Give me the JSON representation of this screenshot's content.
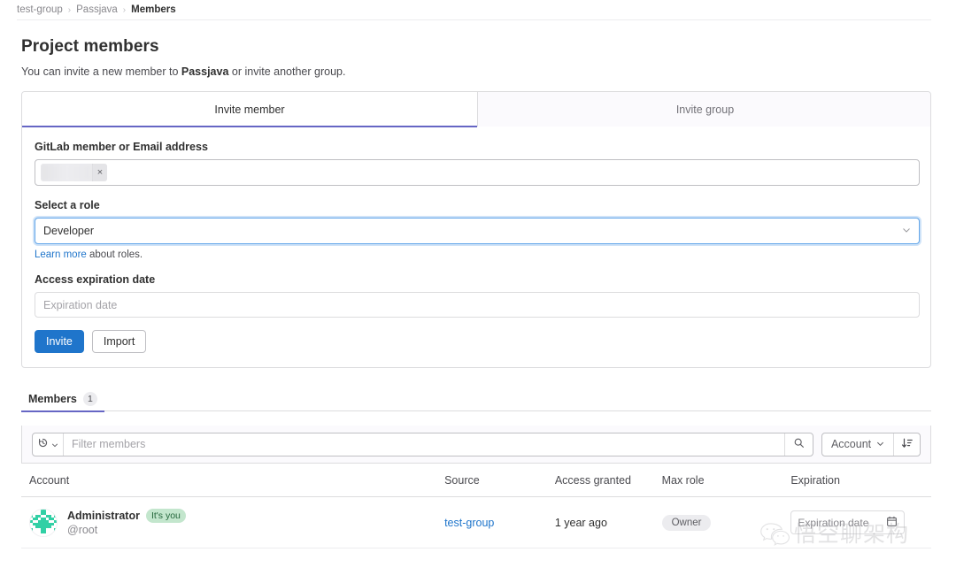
{
  "breadcrumb": {
    "items": [
      {
        "label": "test-group",
        "current": false
      },
      {
        "label": "Passjava",
        "current": false
      },
      {
        "label": "Members",
        "current": true
      }
    ],
    "separator": "›"
  },
  "header": {
    "title": "Project members",
    "description_prefix": "You can invite a new member to ",
    "description_project": "Passjava",
    "description_suffix": " or invite another group."
  },
  "invite_card": {
    "tabs": [
      {
        "label": "Invite member",
        "active": true
      },
      {
        "label": "Invite group",
        "active": false
      }
    ],
    "member_field": {
      "label": "GitLab member or Email address",
      "token_value": "",
      "token_remove_icon": "×"
    },
    "role_field": {
      "label": "Select a role",
      "value": "Developer",
      "chevron_icon": "⌄",
      "helper_link": "Learn more",
      "helper_rest": " about roles."
    },
    "expiration_field": {
      "label": "Access expiration date",
      "placeholder": "Expiration date"
    },
    "buttons": {
      "primary": "Invite",
      "secondary": "Import"
    }
  },
  "members_section": {
    "tab_label": "Members",
    "tab_count": "1",
    "toolbar": {
      "history_icon": "history-icon",
      "history_chevron": "⌄",
      "filter_placeholder": "Filter members",
      "search_icon": "search-icon",
      "sort_label": "Account",
      "sort_chevron": "⌄",
      "sort_direction_icon": "sort-ascending-icon"
    },
    "columns": [
      "Account",
      "Source",
      "Access granted",
      "Max role",
      "Expiration"
    ],
    "rows": [
      {
        "avatar": "identicon-green",
        "name": "Administrator",
        "badge": "It's you",
        "handle": "@root",
        "source": "test-group",
        "access_granted": "1 year ago",
        "max_role": "Owner",
        "expiration_placeholder": "Expiration date",
        "expiration_icon": "calendar-icon"
      }
    ]
  },
  "watermark": {
    "text": "悟空聊架构",
    "logo": "wechat-logo"
  },
  "colors": {
    "accent_tab": "#6666c4",
    "link": "#1f75cb",
    "primary_button": "#1f75cb",
    "badge_you_bg": "#c3e6cd",
    "badge_you_text": "#24663b",
    "focus_ring": "#cfe3f8",
    "identicon_green": "#31d0a5"
  }
}
